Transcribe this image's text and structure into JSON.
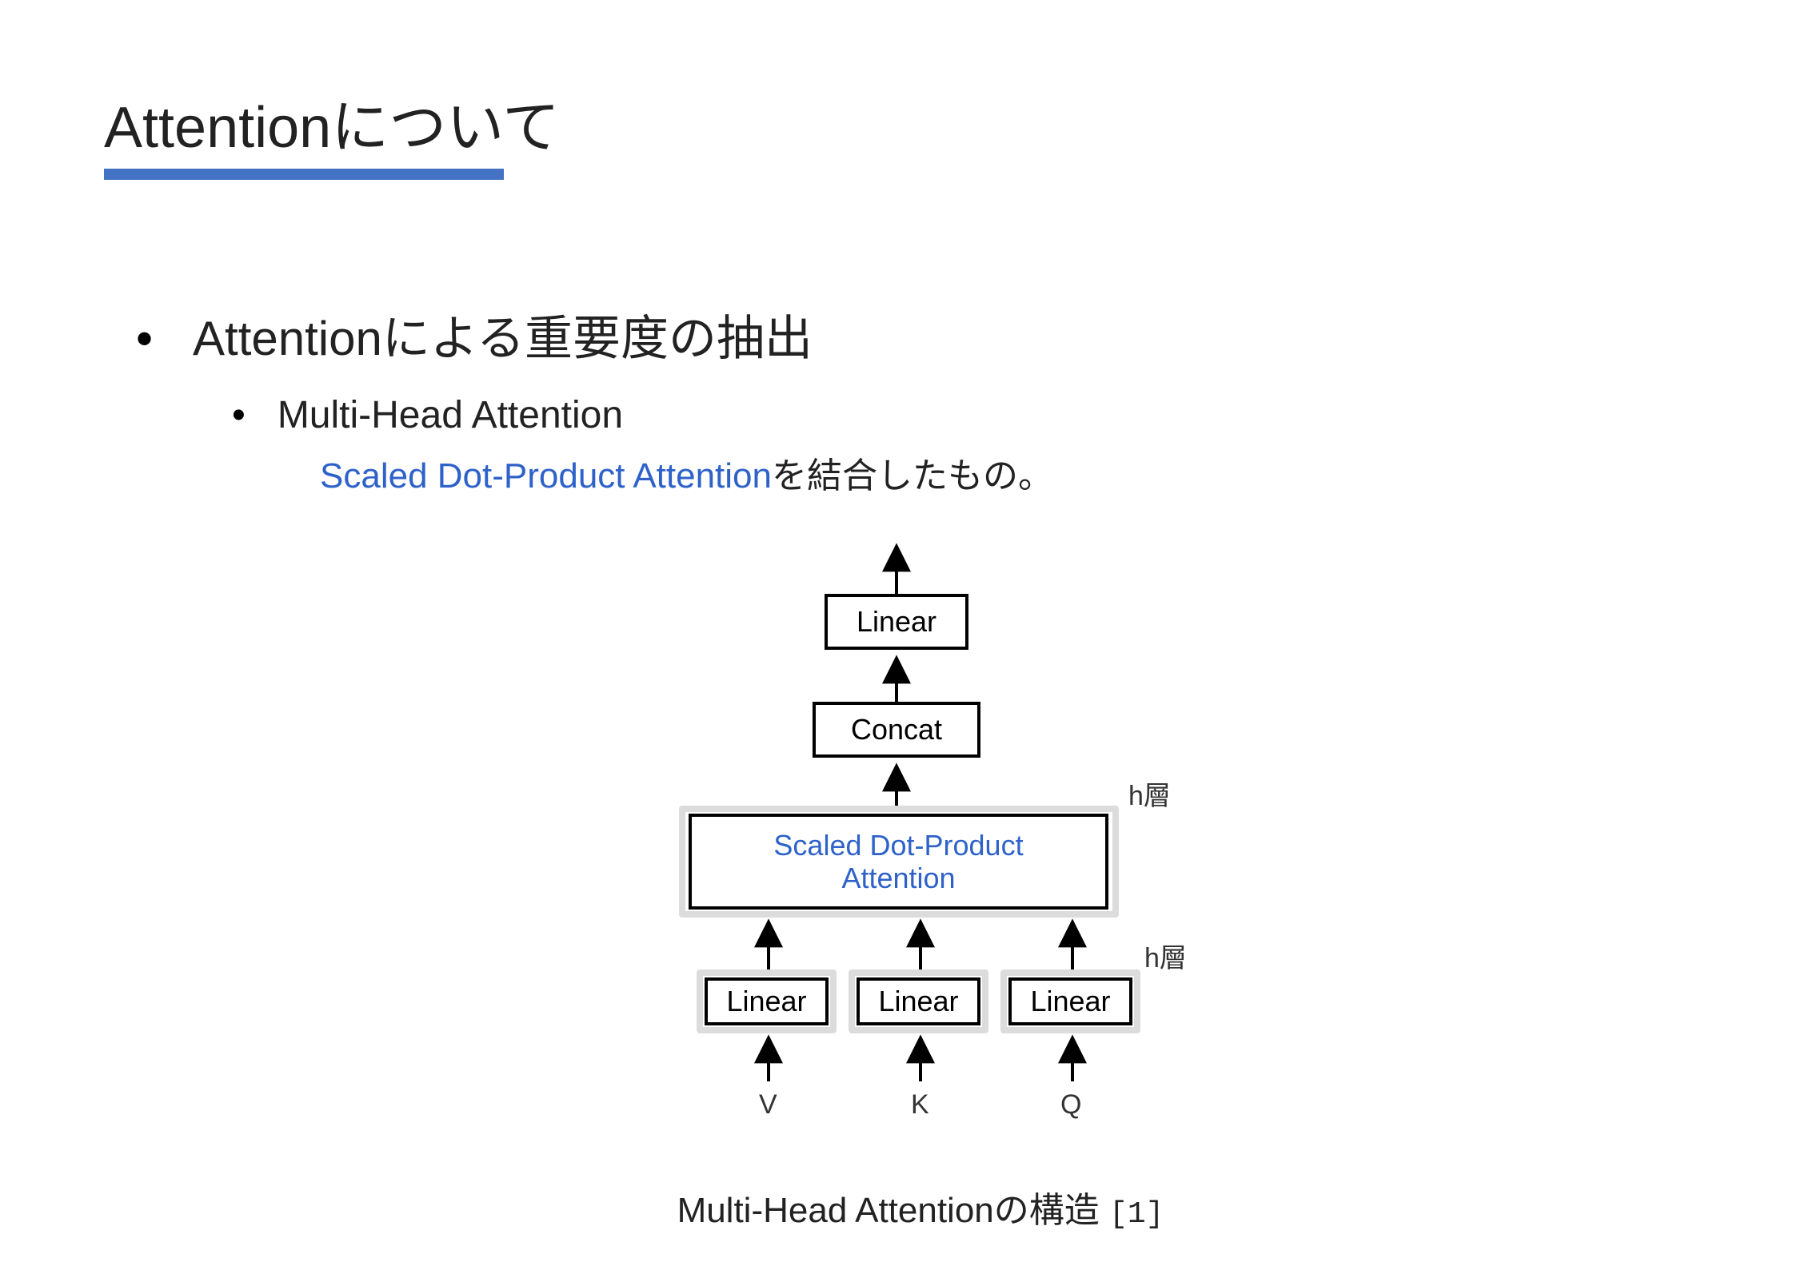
{
  "title": "Attentionについて",
  "bullet_main": "Attentionによる重要度の抽出",
  "bullet_sub": "Multi-Head Attention",
  "desc_blue": "Scaled Dot-Product Attention",
  "desc_black": "を結合したもの。",
  "diagram": {
    "top_linear": "Linear",
    "concat": "Concat",
    "sdpa_line1": "Scaled Dot-Product",
    "sdpa_line2": "Attention",
    "linear_v": "Linear",
    "linear_k": "Linear",
    "linear_q": "Linear",
    "h_label_upper": "h層",
    "h_label_lower": "h層",
    "V": "V",
    "K": "K",
    "Q": "Q"
  },
  "caption_text": "Multi-Head Attentionの構造 ",
  "caption_ref": "[1]"
}
